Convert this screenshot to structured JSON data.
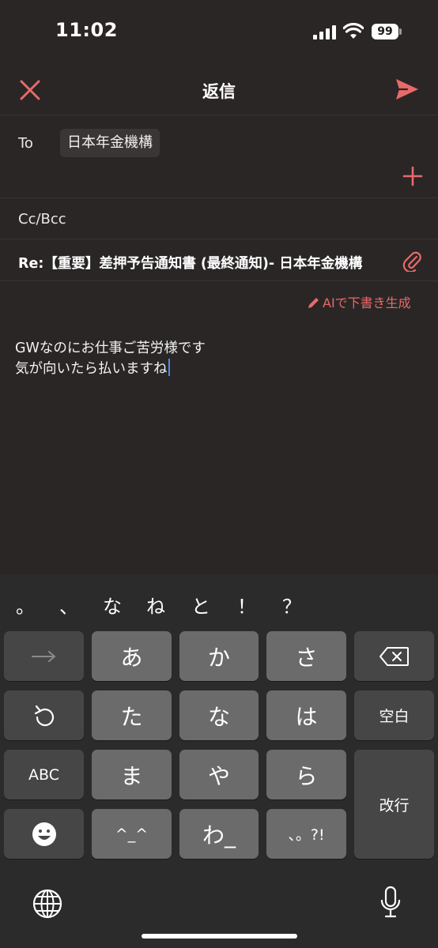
{
  "status_bar": {
    "time": "11:02",
    "battery": "99"
  },
  "nav": {
    "title": "返信"
  },
  "compose": {
    "to_label": "To",
    "to_recipient": "日本年金機構",
    "cc_label": "Cc/Bcc",
    "subject": "Re:【重要】差押予告通知書 (最終通知)- 日本年金機構",
    "ai_draft_label": "AIで下書き生成",
    "body_line1": "GWなのにお仕事ご苦労様です",
    "body_line2": "気が向いたら払いますね"
  },
  "keyboard": {
    "candidates": [
      "。",
      "、",
      "な",
      "ね",
      "と",
      "！",
      "？"
    ],
    "keys": {
      "a": "あ",
      "ka": "か",
      "sa": "さ",
      "ta": "た",
      "na": "な",
      "ha": "は",
      "ma": "ま",
      "ya": "や",
      "ra": "ら",
      "kaomoji": "^_^",
      "wa": "わ_",
      "punct": "、。?!",
      "space": "空白",
      "abc": "ABC",
      "enter": "改行"
    }
  },
  "colors": {
    "accent": "#e86a6a",
    "background": "#2a2626",
    "key": "#6b6b6b",
    "key_dark": "#464646",
    "caret": "#4a8cf0"
  },
  "icons": {
    "close": "close-icon",
    "send": "send-icon",
    "add": "plus-icon",
    "attach": "paperclip-icon",
    "ai": "pencil-icon",
    "next": "arrow-right-icon",
    "undo": "undo-icon",
    "backspace": "backspace-icon",
    "emoji": "emoji-icon",
    "globe": "globe-icon",
    "mic": "microphone-icon"
  }
}
